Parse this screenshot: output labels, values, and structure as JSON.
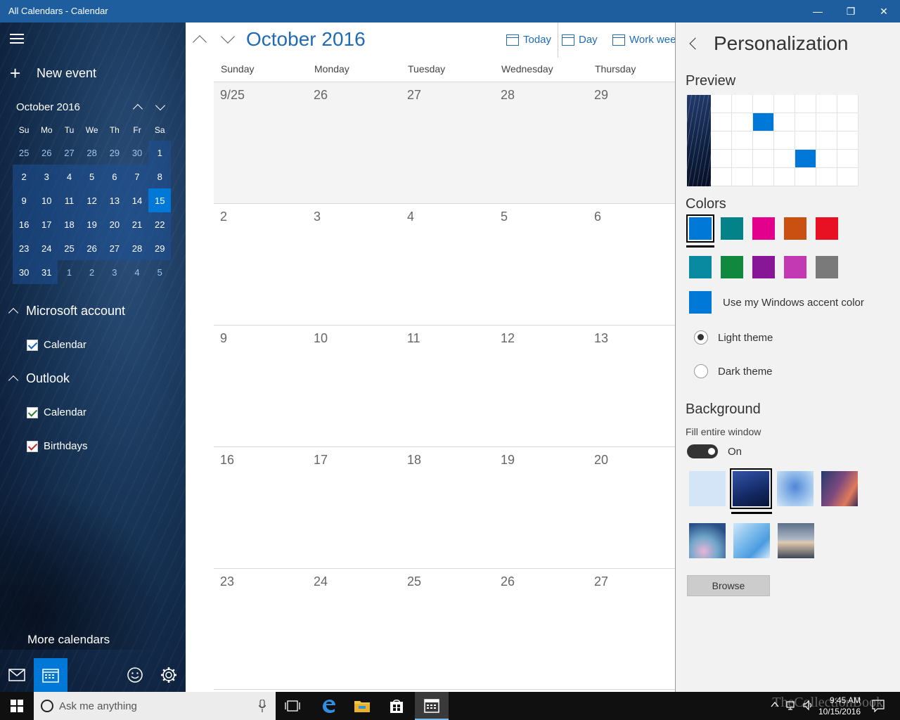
{
  "window": {
    "title": "All Calendars - Calendar",
    "minimize_glyph": "—",
    "restore_glyph": "❐",
    "close_glyph": "✕"
  },
  "sidebar": {
    "new_event_label": "New event",
    "plus_glyph": "+",
    "mini_calendar": {
      "title": "October 2016",
      "weekdays": [
        "Su",
        "Mo",
        "Tu",
        "We",
        "Th",
        "Fr",
        "Sa"
      ],
      "weeks": [
        [
          "25",
          "26",
          "27",
          "28",
          "29",
          "30",
          "1"
        ],
        [
          "2",
          "3",
          "4",
          "5",
          "6",
          "7",
          "8"
        ],
        [
          "9",
          "10",
          "11",
          "12",
          "13",
          "14",
          "15"
        ],
        [
          "16",
          "17",
          "18",
          "19",
          "20",
          "21",
          "22"
        ],
        [
          "23",
          "24",
          "25",
          "26",
          "27",
          "28",
          "29"
        ],
        [
          "30",
          "31",
          "1",
          "2",
          "3",
          "4",
          "5"
        ]
      ]
    },
    "accounts": [
      {
        "name": "Microsoft account",
        "calendars": [
          {
            "name": "Calendar",
            "color": "#1565c0"
          }
        ]
      },
      {
        "name": "Outlook",
        "calendars": [
          {
            "name": "Calendar",
            "color": "#2e7d32"
          },
          {
            "name": "Birthdays",
            "color": "#c62828"
          }
        ]
      }
    ],
    "more_calendars_label": "More calendars"
  },
  "main": {
    "month_title": "October 2016",
    "toolbar": {
      "today_label": "Today",
      "day_label": "Day",
      "work_week_label": "Work week"
    },
    "weekday_headers": [
      "Sunday",
      "Monday",
      "Tuesday",
      "Wednesday",
      "Thursday"
    ],
    "weeks": [
      [
        "9/25",
        "26",
        "27",
        "28",
        "29"
      ],
      [
        "2",
        "3",
        "4",
        "5",
        "6"
      ],
      [
        "9",
        "10",
        "11",
        "12",
        "13"
      ],
      [
        "16",
        "17",
        "18",
        "19",
        "20"
      ],
      [
        "23",
        "24",
        "25",
        "26",
        "27"
      ]
    ]
  },
  "personalization": {
    "title": "Personalization",
    "preview_heading": "Preview",
    "colors_heading": "Colors",
    "colors": [
      "#0078d7",
      "#038387",
      "#e3008c",
      "#ca5010",
      "#e81123",
      "#0a8aa0",
      "#10893e",
      "#881798",
      "#c239b3",
      "#7a7a7a"
    ],
    "accent_label": "Use my Windows accent color",
    "accent_color": "#0078d7",
    "light_theme_label": "Light theme",
    "dark_theme_label": "Dark theme",
    "background_heading": "Background",
    "fill_window_label": "Fill entire window",
    "toggle_state": "On",
    "browse_label": "Browse"
  },
  "taskbar": {
    "search_placeholder": "Ask me anything",
    "time": "9:45 AM",
    "date": "10/15/2016",
    "watermark": "TheCollectionBook"
  }
}
